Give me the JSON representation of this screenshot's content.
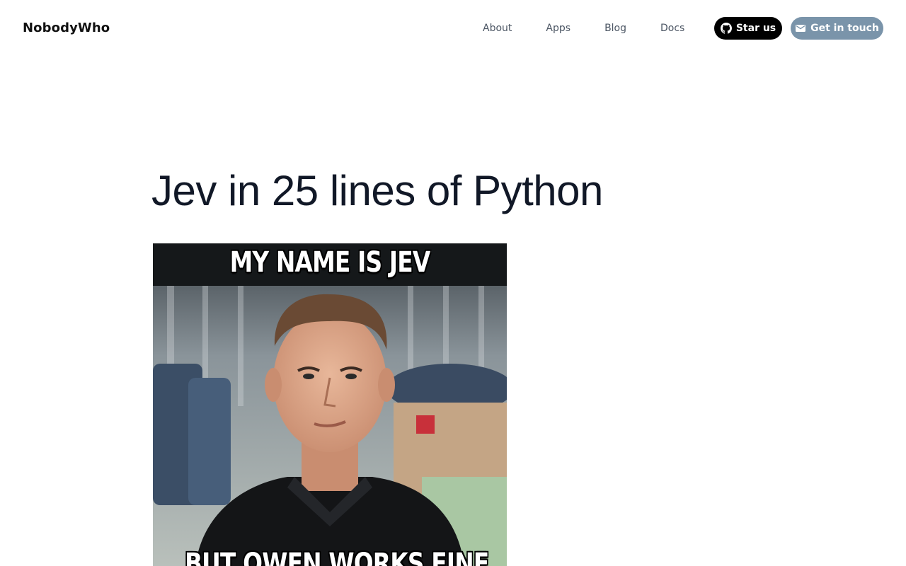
{
  "header": {
    "brand": "NobodyWho",
    "nav": [
      {
        "label": "About"
      },
      {
        "label": "Apps"
      },
      {
        "label": "Blog"
      },
      {
        "label": "Docs"
      }
    ],
    "star_button": {
      "label": "Star us",
      "icon": "github-icon"
    },
    "contact_button": {
      "label": "Get in touch",
      "icon": "mail-icon"
    }
  },
  "article": {
    "title": "Jev in 25 lines of Python",
    "image": {
      "top_caption": "MY NAME IS JEV",
      "bottom_caption": "BUT QWEN WORKS FINE"
    }
  },
  "colors": {
    "star_button_bg": "#000000",
    "contact_button_bg": "#7a94aa",
    "title_text": "#111827",
    "nav_text": "#4b5563"
  }
}
